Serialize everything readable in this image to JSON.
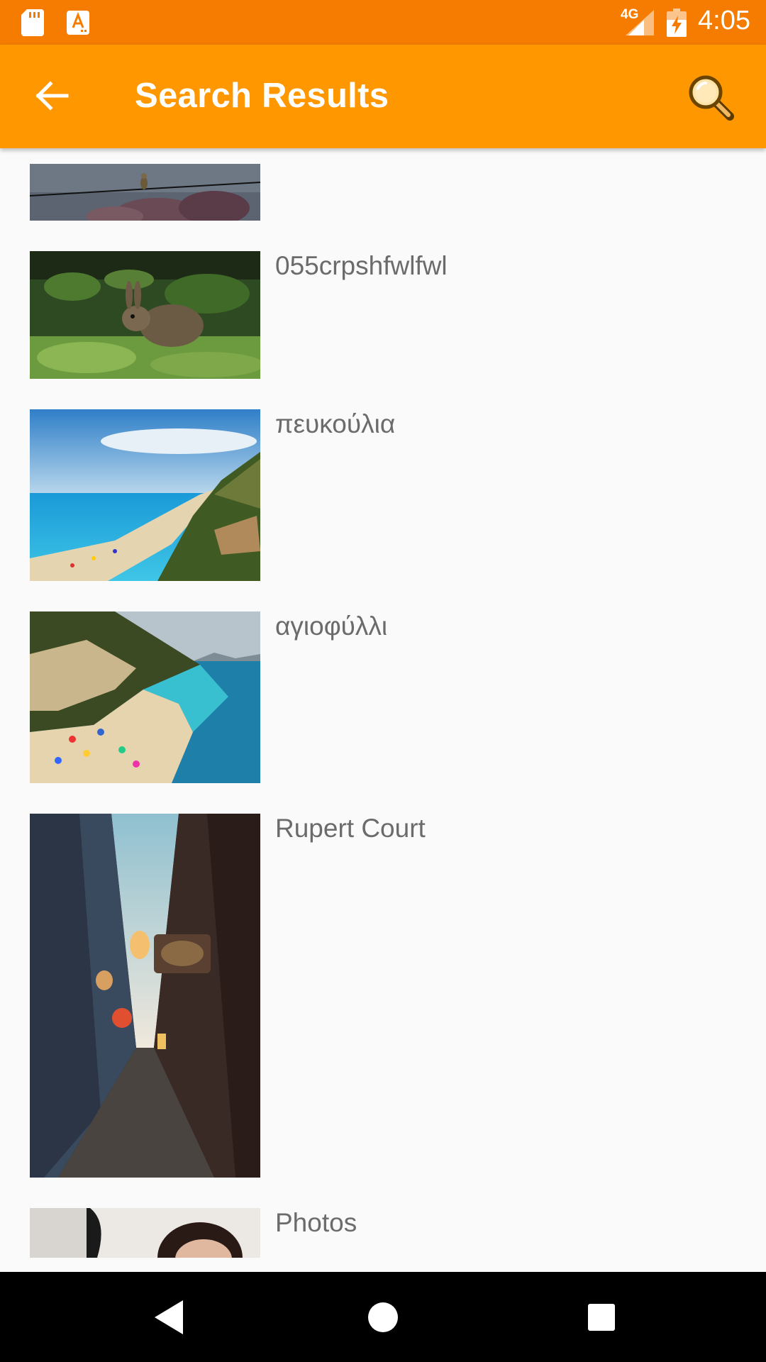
{
  "status_bar": {
    "network": "4G",
    "time": "4:05",
    "icons": [
      "sd-card-icon",
      "app-notification-icon",
      "signal-icon",
      "battery-charging-icon"
    ]
  },
  "app_bar": {
    "title": "Search Results",
    "back_icon": "arrow-back-icon",
    "search_icon": "magnifier-icon"
  },
  "results": [
    {
      "title": ""
    },
    {
      "title": "055crpshfwlfwl"
    },
    {
      "title": "πευκούλια"
    },
    {
      "title": "αγιοφύλλι"
    },
    {
      "title": "Rupert Court"
    },
    {
      "title": "Photos"
    }
  ],
  "nav_bar": {
    "icons": [
      "back-triangle-icon",
      "home-circle-icon",
      "recents-square-icon"
    ]
  }
}
